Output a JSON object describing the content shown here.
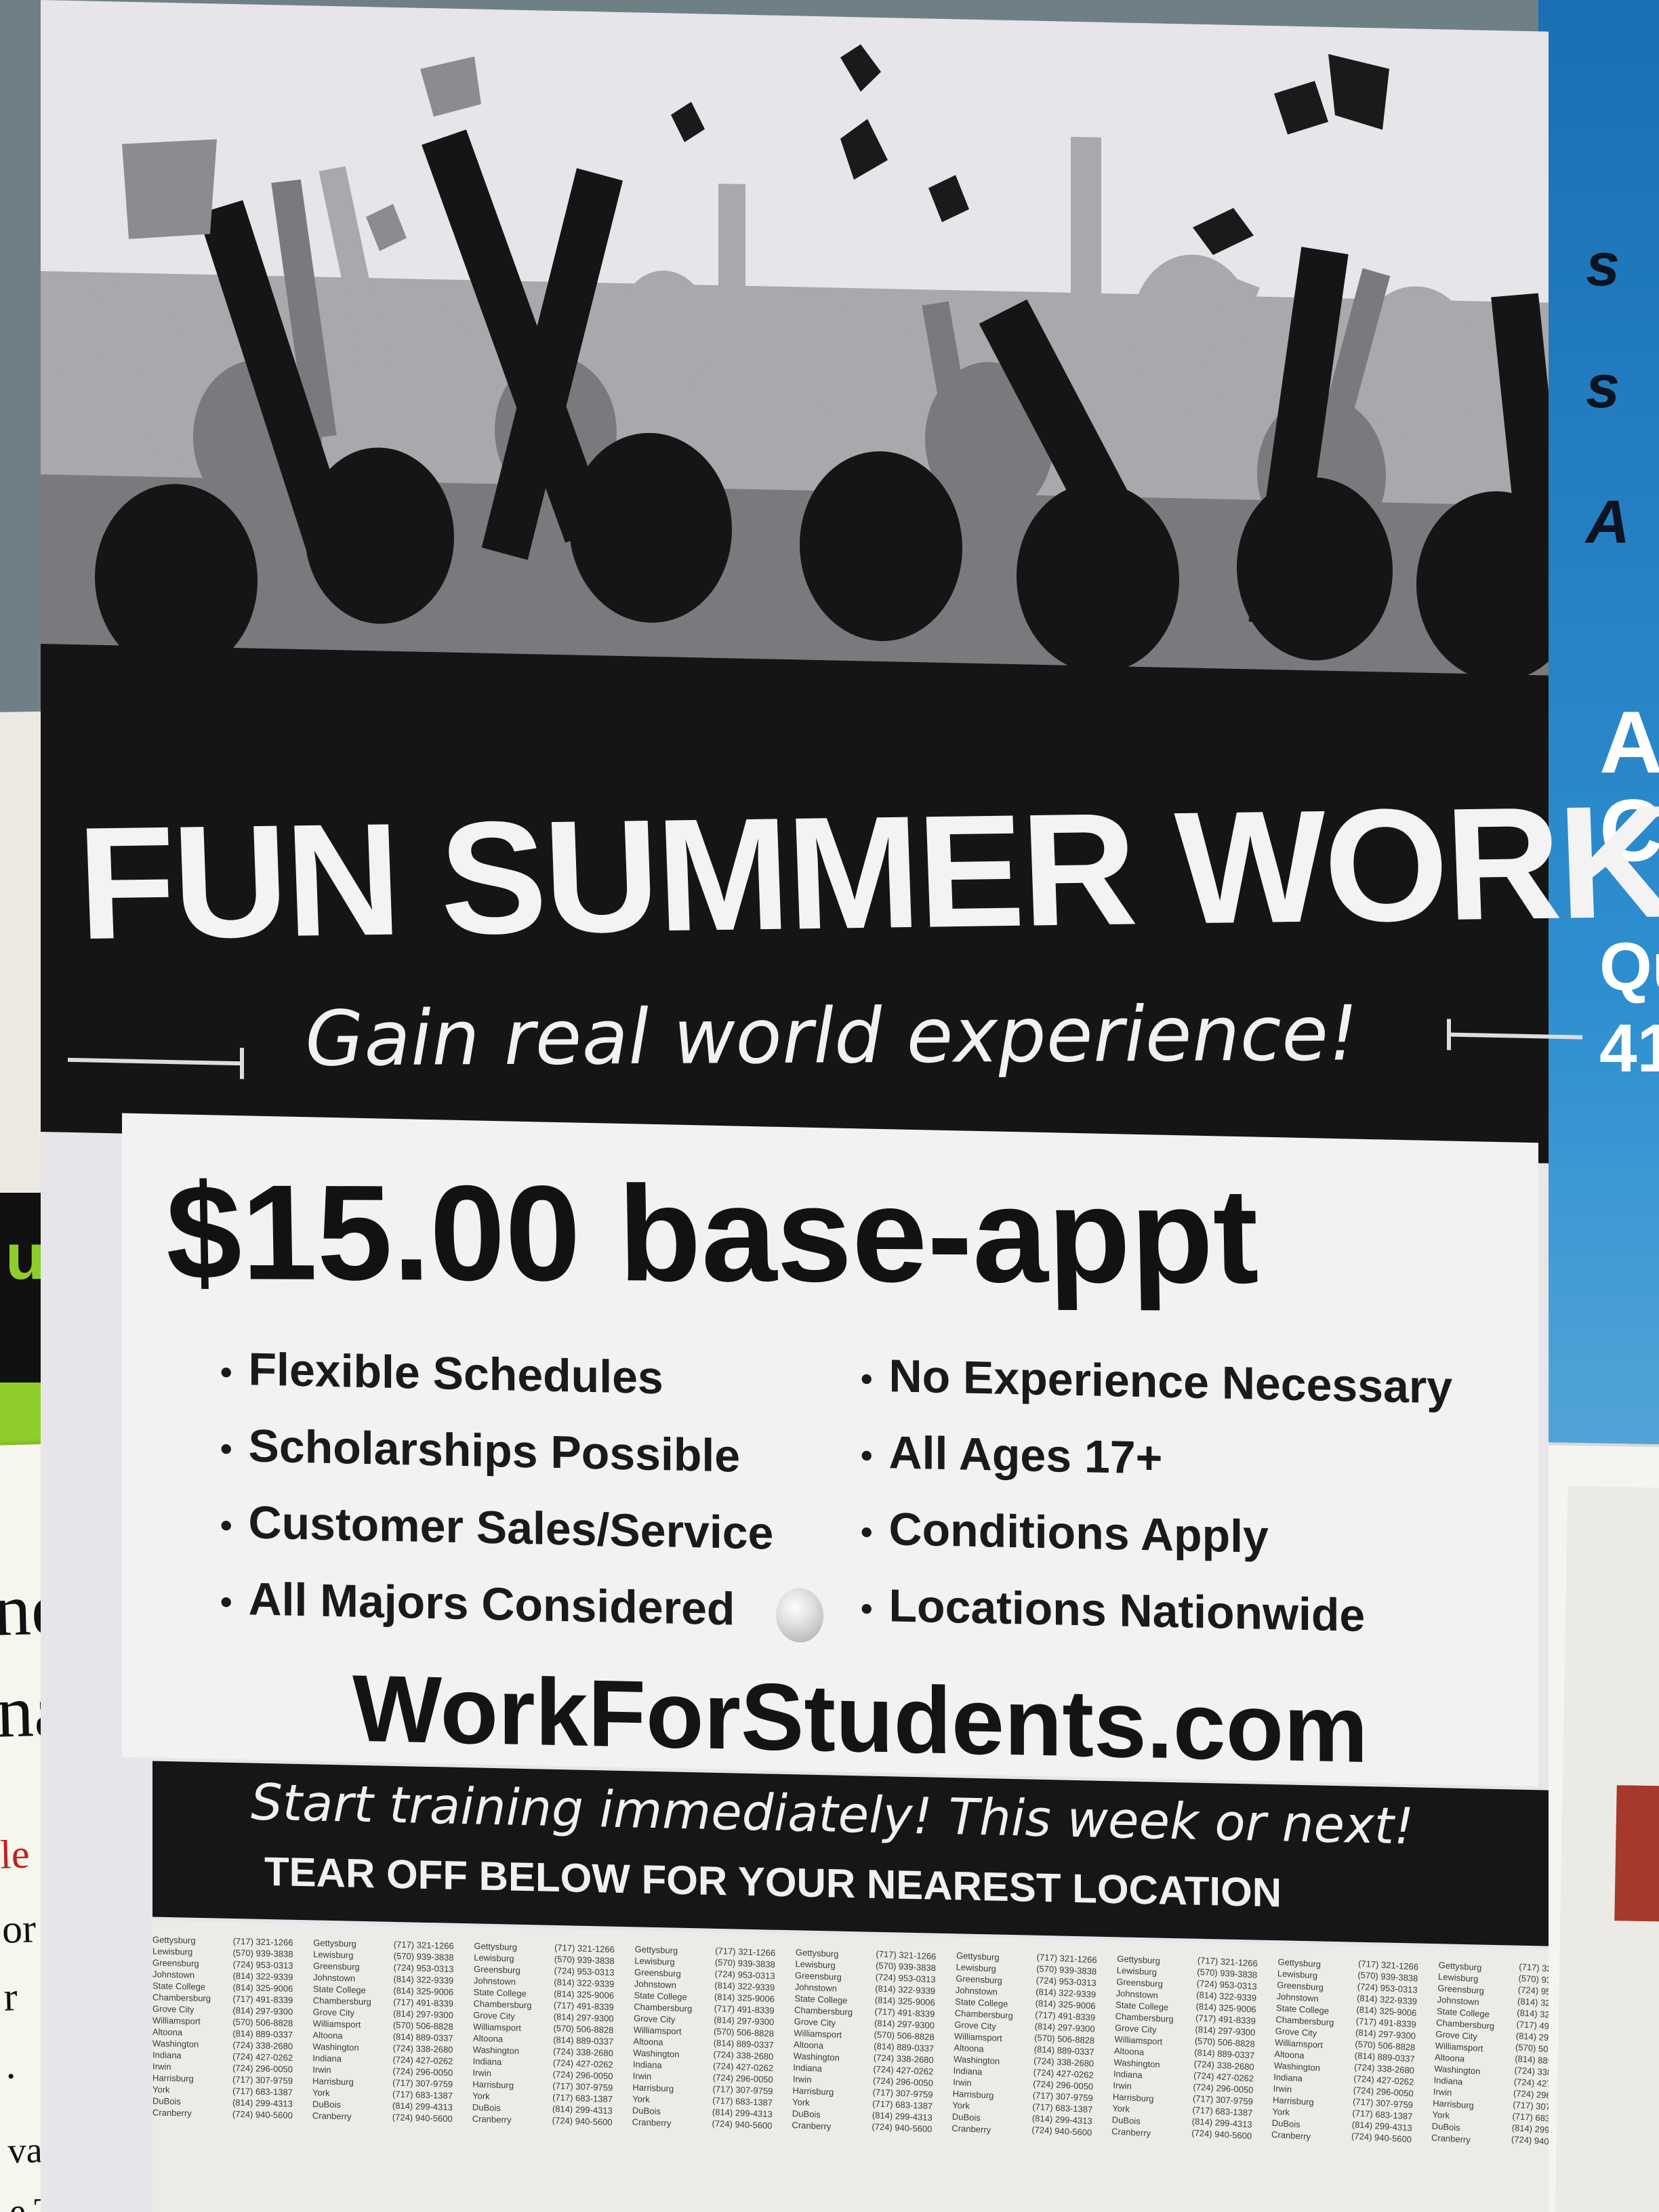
{
  "poster": {
    "headline": "FUN SUMMER WORK",
    "tagline": "Gain real world experience!",
    "pay": "$15.00 base-appt",
    "bullets_left": [
      "Flexible Schedules",
      "Scholarships Possible",
      "Customer Sales/Service",
      "All Majors Considered"
    ],
    "bullets_right": [
      "No Experience Necessary",
      "All Ages 17+",
      "Conditions Apply",
      "Locations Nationwide"
    ],
    "website": "WorkForStudents.com",
    "footer_script": "Start training immediately! This week or next!",
    "footer_caps": "TEAR OFF BELOW FOR YOUR NEAREST LOCATION"
  },
  "tear_off": {
    "cities": [
      "Gettysburg",
      "Lewisburg",
      "Greensburg",
      "Johnstown",
      "State College",
      "Chambersburg",
      "Grove City",
      "Williamsport",
      "Altoona",
      "Washington",
      "Indiana",
      "Irwin",
      "Harrisburg",
      "York",
      "DuBois",
      "Cranberry"
    ],
    "phones": [
      "(717) 321-1266",
      "(570) 939-3838",
      "(724) 953-0313",
      "(814) 322-9339",
      "(814) 325-9006",
      "(717) 491-8339",
      "(814) 297-9300",
      "(570) 506-8828",
      "(814) 889-0337",
      "(724) 338-2680",
      "(724) 427-0262",
      "(724) 296-0050",
      "(717) 307-9759",
      "(717) 683-1387",
      "(814) 299-4313",
      "(724) 940-5600"
    ]
  },
  "left_fragments": {
    "green_text": "urs",
    "note_lines": [
      "ne",
      "na",
      "le",
      "or",
      "r",
      ".",
      "vas",
      "e TOP"
    ]
  },
  "right_fragments": [
    "A",
    "Cl",
    "Qu",
    "41"
  ]
}
